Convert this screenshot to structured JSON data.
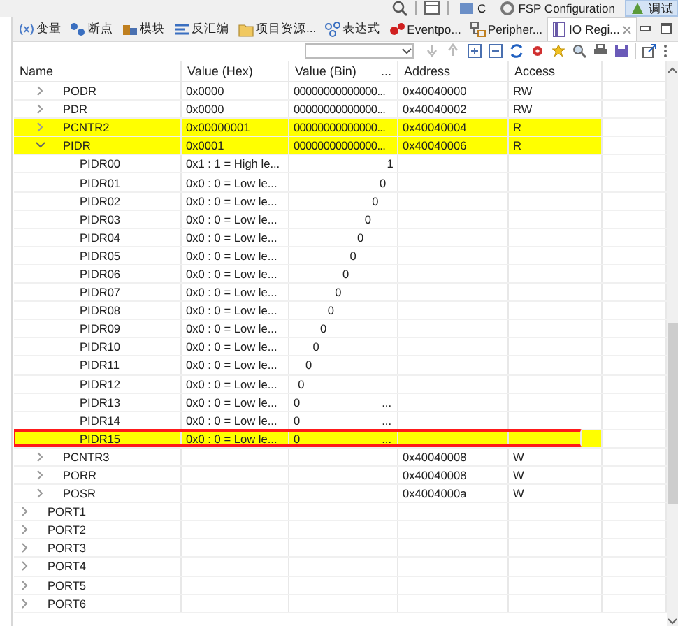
{
  "perspective_bar": [
    {
      "label": "C",
      "selected": false
    },
    {
      "label": "FSP Configuration",
      "selected": false
    },
    {
      "label": "调试",
      "selected": true
    }
  ],
  "tabs": [
    {
      "label": "变量",
      "selected": false,
      "kind": "variables"
    },
    {
      "label": "断点",
      "selected": false,
      "kind": "breakpoints"
    },
    {
      "label": "模块",
      "selected": false,
      "kind": "modules"
    },
    {
      "label": "反汇编",
      "selected": false,
      "kind": "disassembly"
    },
    {
      "label": "项目资源...",
      "selected": false,
      "kind": "folder"
    },
    {
      "label": "表达式",
      "selected": false,
      "kind": "expressions"
    },
    {
      "label": "Eventpo...",
      "selected": false,
      "kind": "eventpoints"
    },
    {
      "label": "Peripher...",
      "selected": false,
      "kind": "peripherals"
    },
    {
      "label": "IO Regi...",
      "selected": true,
      "kind": "registers"
    }
  ],
  "columns": [
    {
      "label": "Name"
    },
    {
      "label": "Value (Hex)"
    },
    {
      "label": "Value (Bin)",
      "more": "..."
    },
    {
      "label": "Address"
    },
    {
      "label": "Access"
    }
  ],
  "registers": [
    {
      "name": "PODR",
      "hex": "0x0000",
      "bin": "00000000000000...",
      "address": "0x40040000",
      "access": "RW",
      "expanded": false,
      "highlighted": false
    },
    {
      "name": "PDR",
      "hex": "0x0000",
      "bin": "00000000000000...",
      "address": "0x40040002",
      "access": "RW",
      "expanded": false,
      "highlighted": false
    },
    {
      "name": "PCNTR2",
      "hex": "0x00000001",
      "bin": "00000000000000...",
      "address": "0x40040004",
      "access": "R",
      "expanded": false,
      "highlighted": true
    },
    {
      "name": "PIDR",
      "hex": "0x0001",
      "bin": "00000000000000...",
      "address": "0x40040006",
      "access": "R",
      "expanded": true,
      "highlighted": true,
      "children": [
        {
          "name": "PIDR00",
          "hex": "0x1 : 1 = High le...",
          "bin": "1",
          "highlighted": false,
          "outlined": false
        },
        {
          "name": "PIDR01",
          "hex": "0x0 : 0 = Low le...",
          "bin": "0",
          "highlighted": false,
          "outlined": false
        },
        {
          "name": "PIDR02",
          "hex": "0x0 : 0 = Low le...",
          "bin": "0",
          "highlighted": false,
          "outlined": false
        },
        {
          "name": "PIDR03",
          "hex": "0x0 : 0 = Low le...",
          "bin": "0",
          "highlighted": false,
          "outlined": false
        },
        {
          "name": "PIDR04",
          "hex": "0x0 : 0 = Low le...",
          "bin": "0",
          "highlighted": false,
          "outlined": false
        },
        {
          "name": "PIDR05",
          "hex": "0x0 : 0 = Low le...",
          "bin": "0",
          "highlighted": false,
          "outlined": false
        },
        {
          "name": "PIDR06",
          "hex": "0x0 : 0 = Low le...",
          "bin": "0",
          "highlighted": false,
          "outlined": false
        },
        {
          "name": "PIDR07",
          "hex": "0x0 : 0 = Low le...",
          "bin": "0",
          "highlighted": false,
          "outlined": false
        },
        {
          "name": "PIDR08",
          "hex": "0x0 : 0 = Low le...",
          "bin": "0",
          "highlighted": false,
          "outlined": false
        },
        {
          "name": "PIDR09",
          "hex": "0x0 : 0 = Low le...",
          "bin": "0",
          "highlighted": false,
          "outlined": false
        },
        {
          "name": "PIDR10",
          "hex": "0x0 : 0 = Low le...",
          "bin": "0",
          "highlighted": false,
          "outlined": false
        },
        {
          "name": "PIDR11",
          "hex": "0x0 : 0 = Low le...",
          "bin": "0",
          "highlighted": false,
          "outlined": false
        },
        {
          "name": "PIDR12",
          "hex": "0x0 : 0 = Low le...",
          "bin": "0",
          "highlighted": false,
          "outlined": false
        },
        {
          "name": "PIDR13",
          "hex": "0x0 : 0 = Low le...",
          "bin": "0",
          "bin_more": "...",
          "highlighted": false,
          "outlined": false
        },
        {
          "name": "PIDR14",
          "hex": "0x0 : 0 = Low le...",
          "bin": "0",
          "bin_more": "...",
          "highlighted": false,
          "outlined": false
        },
        {
          "name": "PIDR15",
          "hex": "0x0 : 0 = Low le...",
          "bin": "0",
          "bin_more": "...",
          "highlighted": true,
          "outlined": true
        }
      ]
    },
    {
      "name": "PCNTR3",
      "address": "0x40040008",
      "access": "W",
      "expanded": false,
      "highlighted": false
    },
    {
      "name": "PORR",
      "address": "0x40040008",
      "access": "W",
      "expanded": false,
      "highlighted": false
    },
    {
      "name": "POSR",
      "address": "0x4004000a",
      "access": "W",
      "expanded": false,
      "highlighted": false
    }
  ],
  "ports": [
    {
      "name": "PORT1",
      "expanded": false
    },
    {
      "name": "PORT2",
      "expanded": false
    },
    {
      "name": "PORT3",
      "expanded": false
    },
    {
      "name": "PORT4",
      "expanded": false
    },
    {
      "name": "PORT5",
      "expanded": false
    },
    {
      "name": "PORT6",
      "expanded": false
    }
  ]
}
